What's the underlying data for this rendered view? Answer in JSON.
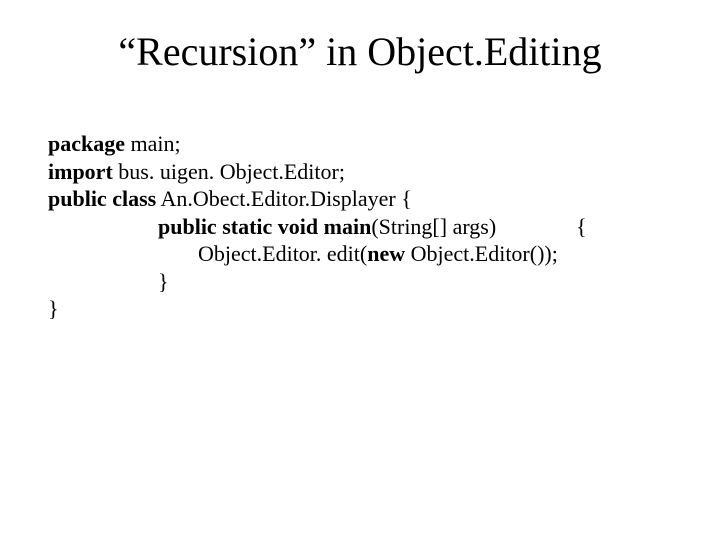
{
  "title": "“Recursion” in Object.Editing",
  "code": {
    "l1": {
      "kw": "package",
      "rest": " main;"
    },
    "l2": {
      "kw": "import",
      "rest": " bus. uigen. Object.Editor;"
    },
    "l3": {
      "kw": "public class",
      "rest": " An.Obect.Editor.Displayer {"
    },
    "l4": {
      "kw": "public static void main",
      "rest1": "(String[] args)",
      "rest2": "{"
    },
    "l5": {
      "pre": "Object.Editor. edit(",
      "kw": "new",
      "post": " Object.Editor());"
    },
    "l6": "}",
    "l7": "}"
  }
}
